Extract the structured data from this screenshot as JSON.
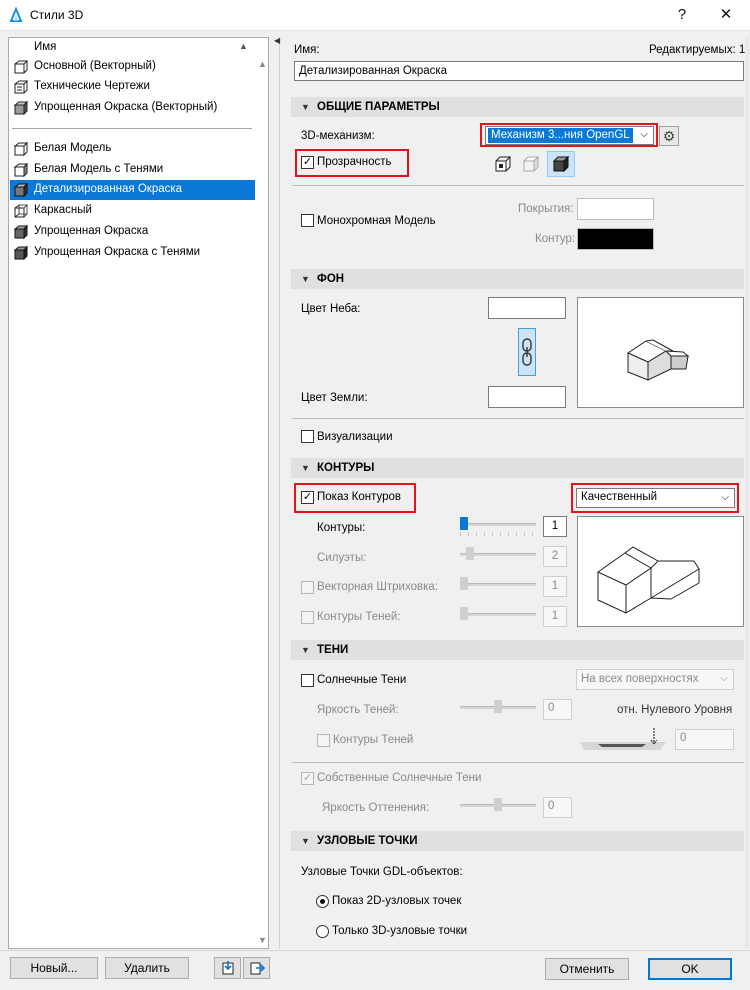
{
  "window": {
    "title": "Стили 3D",
    "help": "?",
    "close": "✕"
  },
  "list": {
    "header": "Имя",
    "items": [
      {
        "label": "Основной (Векторный)"
      },
      {
        "label": "Технические Чертежи"
      },
      {
        "label": "Упрощенная Окраска (Векторный)"
      },
      {
        "label": "Белая Модель"
      },
      {
        "label": "Белая Модель с Тенями"
      },
      {
        "label": "Детализированная Окраска"
      },
      {
        "label": "Каркасный"
      },
      {
        "label": "Упрощенная Окраска"
      },
      {
        "label": "Упрощенная Окраска с Тенями"
      }
    ],
    "selected_index": 5
  },
  "buttons": {
    "new": "Новый...",
    "delete": "Удалить",
    "cancel": "Отменить",
    "ok": "OK"
  },
  "name_section": {
    "label": "Имя:",
    "editable_label": "Редактируемых: 1",
    "value": "Детализированная Окраска"
  },
  "general": {
    "header": "ОБЩИЕ ПАРАМЕТРЫ",
    "engine_label": "3D-механизм:",
    "engine_value": "Механизм 3...ния OpenGL",
    "transparency_label": "Прозрачность",
    "transparency_checked": true,
    "mono_label": "Монохромная Модель",
    "mono_checked": false,
    "coverage_label": "Покрытия:",
    "contour_label": "Контур:",
    "contour_color": "#000000"
  },
  "background": {
    "header": "ФОН",
    "sky_label": "Цвет Неба:",
    "ground_label": "Цвет Земли:",
    "render_label": "Визуализации",
    "render_checked": false
  },
  "contours": {
    "header": "КОНТУРЫ",
    "show_label": "Показ Контуров",
    "show_checked": true,
    "quality_value": "Качественный",
    "rows": [
      {
        "label": "Контуры:",
        "value": "1",
        "enabled": true
      },
      {
        "label": "Силуэты:",
        "value": "2",
        "enabled": false
      },
      {
        "label": "Векторная Штриховка:",
        "value": "1",
        "enabled": false
      },
      {
        "label": "Контуры Теней:",
        "value": "1",
        "enabled": false
      }
    ]
  },
  "shadows": {
    "header": "ТЕНИ",
    "sun_label": "Солнечные Тени",
    "sun_checked": false,
    "surfaces_value": "На всех поверхностях",
    "brightness_label": "Яркость Теней:",
    "brightness_value": "0",
    "zero_level_label": "отн. Нулевого Уровня",
    "contours_label": "Контуры Теней",
    "level_value": "0",
    "own_label": "Собственные Солнечные Тени",
    "own_checked": true,
    "shade_label": "Яркость Оттенения:",
    "shade_value": "0"
  },
  "hotspots": {
    "header": "УЗЛОВЫЕ ТОЧКИ",
    "gdl_label": "Узловые Точки GDL-объектов:",
    "opt_2d": "Показ 2D-узловых точек",
    "opt_3d": "Только 3D-узловые точки",
    "selected": "2d"
  },
  "colors": {
    "selection": "#0a78d7",
    "highlight_red": "#e3141d",
    "section_bg": "#e0e0e0"
  }
}
